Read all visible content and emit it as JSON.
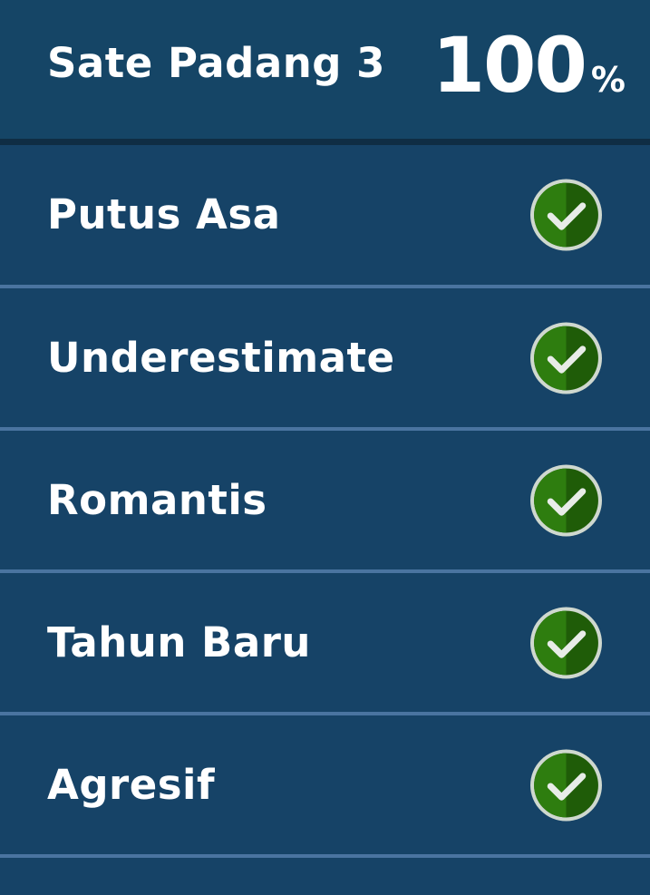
{
  "header": {
    "pack_title": "Sate Padang 3",
    "progress_value": "100",
    "progress_unit": "%"
  },
  "levels": [
    {
      "name": "Putus Asa",
      "status_icon": "check-circle-icon"
    },
    {
      "name": "Underestimate",
      "status_icon": "check-circle-icon"
    },
    {
      "name": "Romantis",
      "status_icon": "check-circle-icon"
    },
    {
      "name": "Tahun Baru",
      "status_icon": "check-circle-icon"
    },
    {
      "name": "Agresif",
      "status_icon": "check-circle-icon"
    }
  ],
  "colors": {
    "background": "#164367",
    "header": "#154566",
    "divider": "#4a74a0",
    "check_green": "#2e7d0f",
    "check_green_dark": "#1f5c08"
  }
}
